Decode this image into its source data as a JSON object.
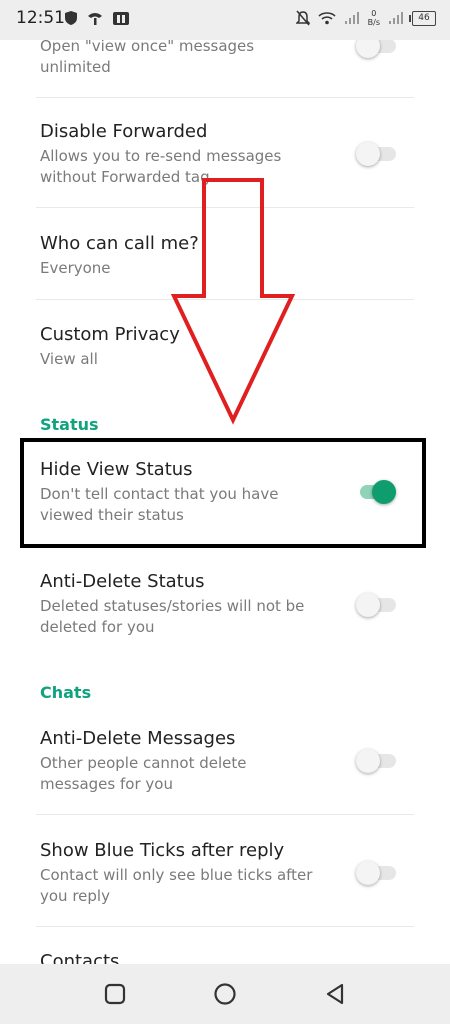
{
  "status_bar": {
    "time": "12:51",
    "net_rate_top": "0",
    "net_rate_unit": "B/s",
    "battery": "46"
  },
  "settings": {
    "items": [
      {
        "title": "",
        "subtitle_line1": "Open \"view once\" messages",
        "subtitle_line2": "unlimited",
        "toggle": false
      },
      {
        "title": "Disable Forwarded",
        "subtitle_line1": "Allows you to re-send messages",
        "subtitle_line2": "without Forwarded tag",
        "toggle": false
      },
      {
        "title": "Who can call me?",
        "subtitle_line1": "Everyone"
      },
      {
        "title": "Custom Privacy",
        "subtitle_line1": "View all"
      },
      {
        "title": "Hide View Status",
        "subtitle_line1": "Don't tell contact that you have",
        "subtitle_line2": "viewed their status",
        "toggle": true
      },
      {
        "title": "Anti-Delete Status",
        "subtitle_line1": "Deleted statuses/stories will not be",
        "subtitle_line2": "deleted for you",
        "toggle": false
      },
      {
        "title": "Anti-Delete Messages",
        "subtitle_line1": "Other people cannot delete",
        "subtitle_line2": "messages for you",
        "toggle": false
      },
      {
        "title": "Show Blue Ticks after reply",
        "subtitle_line1": "Contact will only see blue ticks after",
        "subtitle_line2": "you reply",
        "toggle": false
      },
      {
        "title": "Contacts"
      }
    ],
    "sections": {
      "status": "Status",
      "chats": "Chats"
    }
  },
  "colors": {
    "accent": "#10a37f",
    "toggle_on": "#0f9d6e",
    "annotation_arrow": "#e02020",
    "annotation_box": "#000000"
  },
  "annotations": {
    "arrow_icon": "down-arrow-outline",
    "highlight": "box-around-hide-view-status"
  }
}
